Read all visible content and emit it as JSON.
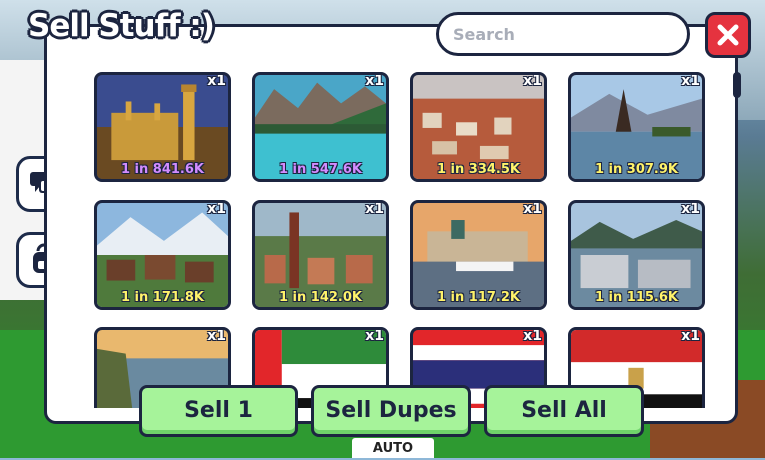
{
  "title": "Sell Stuff :)",
  "search": {
    "placeholder": "Search"
  },
  "background": {
    "auto_label": "AUTO"
  },
  "items": [
    {
      "count": "x1",
      "rarity": "1 in 841.6K",
      "rarity_color": "#d28cff",
      "subject": "london-parliament"
    },
    {
      "count": "x1",
      "rarity": "1 in 547.6K",
      "rarity_color": "#d28cff",
      "subject": "mountain-lake"
    },
    {
      "count": "x1",
      "rarity": "1 in 334.5K",
      "rarity_color": "#fff36a",
      "subject": "old-town-rooftops"
    },
    {
      "count": "x1",
      "rarity": "1 in 307.9K",
      "rarity_color": "#fff36a",
      "subject": "temple-lake"
    },
    {
      "count": "x1",
      "rarity": "1 in 171.8K",
      "rarity_color": "#fff36a",
      "subject": "alpine-village"
    },
    {
      "count": "x1",
      "rarity": "1 in 142.0K",
      "rarity_color": "#fff36a",
      "subject": "city-spire"
    },
    {
      "count": "x1",
      "rarity": "1 in 117.2K",
      "rarity_color": "#fff36a",
      "subject": "harbor-palace"
    },
    {
      "count": "x1",
      "rarity": "1 in 115.6K",
      "rarity_color": "#fff36a",
      "subject": "coastal-town"
    },
    {
      "count": "x1",
      "rarity": "",
      "rarity_color": "#fff36a",
      "subject": "sea-cliffs"
    },
    {
      "count": "x1",
      "rarity": "",
      "rarity_color": "#fff36a",
      "subject": "uae-flag"
    },
    {
      "count": "x1",
      "rarity": "",
      "rarity_color": "#fff36a",
      "subject": "thailand-flag"
    },
    {
      "count": "x1",
      "rarity": "",
      "rarity_color": "#fff36a",
      "subject": "egypt-flag"
    }
  ],
  "actions": {
    "sell_one": "Sell 1",
    "sell_dupes": "Sell Dupes",
    "sell_all": "Sell All"
  },
  "colors": {
    "panel_border": "#1c2540",
    "close": "#e5333f",
    "action_button": "#a6f39a"
  }
}
